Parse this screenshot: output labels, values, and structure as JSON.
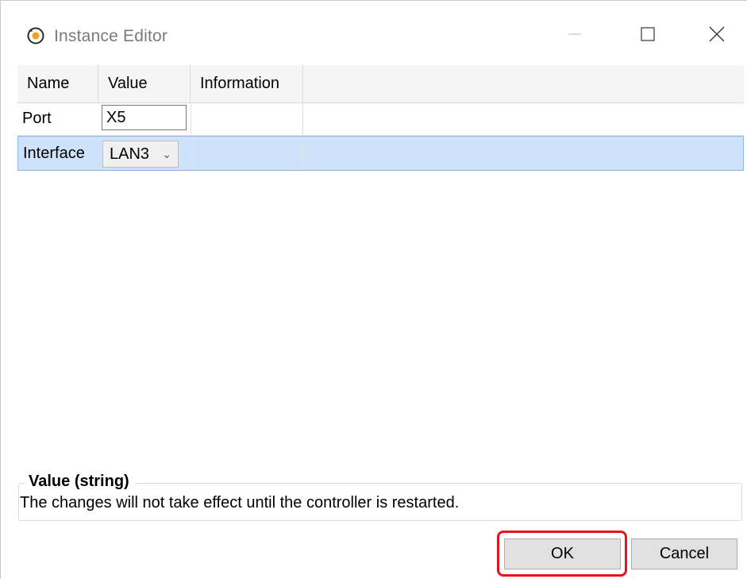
{
  "window": {
    "title": "Instance Editor",
    "icon": "instance-editor-icon"
  },
  "title_bar_buttons": {
    "minimize_icon": "minimize-icon",
    "maximize_icon": "maximize-icon",
    "close_icon": "close-icon"
  },
  "grid": {
    "columns": [
      "Name",
      "Value",
      "Information"
    ],
    "rows": [
      {
        "name": "Port",
        "value": "X5",
        "information": "",
        "editor": "text"
      },
      {
        "name": "Interface",
        "value": "LAN3",
        "information": "",
        "editor": "combo",
        "selected": true
      }
    ]
  },
  "description": {
    "title": "Value (string)",
    "text": "The changes will not take effect until the controller is restarted."
  },
  "buttons": {
    "ok_label": "OK",
    "cancel_label": "Cancel"
  },
  "colors": {
    "selected_row": "#cfe2fb",
    "selected_row_border": "#8fb5ea",
    "highlight": "#e2161b",
    "button_face": "#e1e1e1"
  }
}
